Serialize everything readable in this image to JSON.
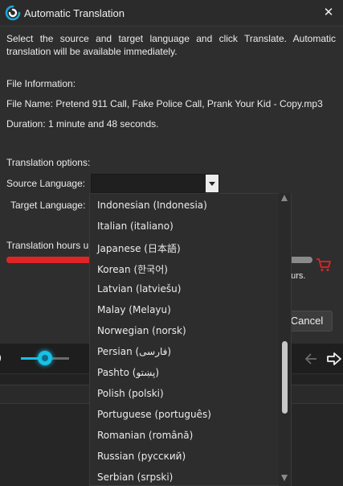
{
  "window": {
    "title": "Automatic Translation",
    "close_label": "✕"
  },
  "dialog": {
    "intro": "Select the source and target language and click Translate. Automatic translation will be available immediately.",
    "file_info_heading": "File Information:",
    "file_name": "File Name: Pretend 911 Call, Fake Police Call, Prank Your Kid - Copy.mp3",
    "duration": "Duration: 1 minute and 48 seconds.",
    "options_heading": "Translation options:",
    "source_label": "Source Language:",
    "source_value": "",
    "target_label": "Target Language:",
    "hours_label": "Translation hours u",
    "hours_suffix": "ours.",
    "hours_used_fraction": 0.34,
    "cancel_label": "Cancel"
  },
  "dropdown": {
    "options": [
      "Indonesian (Indonesia)",
      "Italian (italiano)",
      "Japanese (日本語)",
      "Korean (한국어)",
      "Latvian (latviešu)",
      "Malay (Melayu)",
      "Norwegian (norsk)",
      "Persian (فارسی)",
      "Pashto (پښتو)",
      "Polish (polski)",
      "Portuguese (português)",
      "Romanian (română)",
      "Russian (русский)",
      "Serbian (srpski)"
    ]
  },
  "player": {
    "volume_fraction": 0.55
  },
  "colors": {
    "accent": "#17c1e8",
    "progress": "#e02424",
    "cart": "#e02424"
  },
  "icons": {
    "app": "translation-logo-icon",
    "close": "close-icon",
    "cart": "cart-icon",
    "volume": "volume-icon",
    "back": "arrow-left-icon",
    "forward": "arrow-right-icon"
  }
}
